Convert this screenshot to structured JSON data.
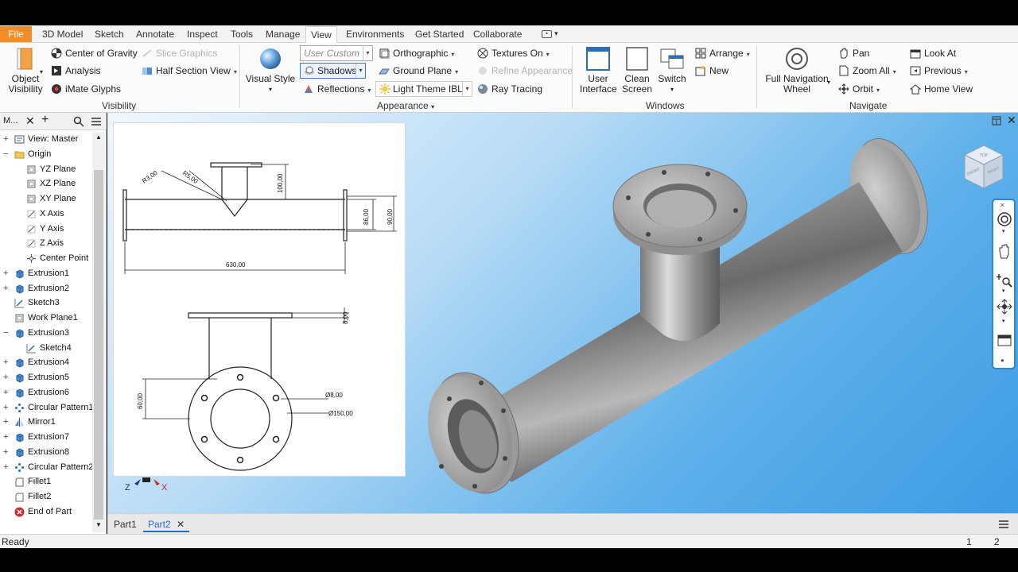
{
  "menu": {
    "file": "File",
    "items": [
      "3D Model",
      "Sketch",
      "Annotate",
      "Inspect",
      "Tools",
      "Manage",
      "View",
      "Environments",
      "Get Started",
      "Collaborate"
    ],
    "active": "View"
  },
  "ribbon": {
    "visibility": {
      "object_visibility": "Object\nVisibility",
      "center_of_gravity": "Center of Gravity",
      "slice_graphics": "Slice Graphics",
      "analysis": "Analysis",
      "half_section_view": "Half Section View",
      "imate_glyphs": "iMate Glyphs",
      "label": "Visibility"
    },
    "appearance": {
      "visual_style": "Visual Style",
      "user_custom": "User Custom",
      "shadows": "Shadows",
      "reflections": "Reflections",
      "orthographic": "Orthographic",
      "ground_plane": "Ground Plane",
      "light_theme": "Light Theme IBL",
      "textures_on": "Textures On",
      "refine_appearance": "Refine Appearance",
      "ray_tracing": "Ray Tracing",
      "label": "Appearance"
    },
    "windows": {
      "user_interface": "User\nInterface",
      "clean_screen": "Clean\nScreen",
      "switch": "Switch",
      "arrange": "Arrange",
      "new": "New",
      "label": "Windows"
    },
    "navigate": {
      "full_navigation_wheel": "Full Navigation\nWheel",
      "pan": "Pan",
      "zoom_all": "Zoom All",
      "orbit": "Orbit",
      "look_at": "Look At",
      "previous": "Previous",
      "home_view": "Home View",
      "label": "Navigate"
    }
  },
  "browser": {
    "title": "M...",
    "items": [
      {
        "label": "View: Master",
        "expander": "+",
        "indent": 0,
        "icon": "view-icon"
      },
      {
        "label": "Origin",
        "expander": "−",
        "indent": 0,
        "icon": "folder-icon"
      },
      {
        "label": "YZ Plane",
        "expander": "",
        "indent": 1,
        "icon": "plane-icon"
      },
      {
        "label": "XZ Plane",
        "expander": "",
        "indent": 1,
        "icon": "plane-icon"
      },
      {
        "label": "XY Plane",
        "expander": "",
        "indent": 1,
        "icon": "plane-icon"
      },
      {
        "label": "X Axis",
        "expander": "",
        "indent": 1,
        "icon": "axis-icon"
      },
      {
        "label": "Y Axis",
        "expander": "",
        "indent": 1,
        "icon": "axis-icon"
      },
      {
        "label": "Z Axis",
        "expander": "",
        "indent": 1,
        "icon": "axis-icon"
      },
      {
        "label": "Center Point",
        "expander": "",
        "indent": 1,
        "icon": "point-icon"
      },
      {
        "label": "Extrusion1",
        "expander": "+",
        "indent": 0,
        "icon": "extrusion-icon"
      },
      {
        "label": "Extrusion2",
        "expander": "+",
        "indent": 0,
        "icon": "extrusion-icon"
      },
      {
        "label": "Sketch3",
        "expander": "",
        "indent": 0,
        "icon": "sketch-icon"
      },
      {
        "label": "Work Plane1",
        "expander": "",
        "indent": 0,
        "icon": "plane-icon"
      },
      {
        "label": "Extrusion3",
        "expander": "−",
        "indent": 0,
        "icon": "extrusion-icon"
      },
      {
        "label": "Sketch4",
        "expander": "",
        "indent": 1,
        "icon": "sketch-icon"
      },
      {
        "label": "Extrusion4",
        "expander": "+",
        "indent": 0,
        "icon": "extrusion-icon"
      },
      {
        "label": "Extrusion5",
        "expander": "+",
        "indent": 0,
        "icon": "extrusion-icon"
      },
      {
        "label": "Extrusion6",
        "expander": "+",
        "indent": 0,
        "icon": "extrusion-icon"
      },
      {
        "label": "Circular Pattern1",
        "expander": "+",
        "indent": 0,
        "icon": "pattern-icon"
      },
      {
        "label": "Mirror1",
        "expander": "+",
        "indent": 0,
        "icon": "mirror-icon"
      },
      {
        "label": "Extrusion7",
        "expander": "+",
        "indent": 0,
        "icon": "extrusion-icon"
      },
      {
        "label": "Extrusion8",
        "expander": "+",
        "indent": 0,
        "icon": "extrusion-icon"
      },
      {
        "label": "Circular Pattern2",
        "expander": "+",
        "indent": 0,
        "icon": "pattern-icon"
      },
      {
        "label": "Fillet1",
        "expander": "",
        "indent": 0,
        "icon": "fillet-icon"
      },
      {
        "label": "Fillet2",
        "expander": "",
        "indent": 0,
        "icon": "fillet-icon"
      },
      {
        "label": "End of Part",
        "expander": "",
        "indent": 0,
        "icon": "end-of-part-icon"
      }
    ]
  },
  "drawing": {
    "dims": {
      "r3": "R3,00",
      "r5": "R5,00",
      "h100": "100,00",
      "d86": "86,00",
      "d90": "90,00",
      "len630": "630,00",
      "t8": "8,00",
      "h60": "60,00",
      "dia8": "Ø8,00",
      "dia150": "Ø150,00"
    }
  },
  "axis_triad": {
    "z": "Z",
    "x": "X"
  },
  "viewcube": {
    "top": "TOP",
    "front": "FRONT",
    "right": "RIGHT"
  },
  "doc_tabs": [
    {
      "label": "Part1",
      "active": false
    },
    {
      "label": "Part2",
      "active": true
    }
  ],
  "status": {
    "text": "Ready",
    "count1": "1",
    "count2": "2"
  },
  "colors": {
    "accent": "#1b6fd1",
    "file_tab": "#f28c28",
    "navbar_border": "#2f86d6"
  }
}
